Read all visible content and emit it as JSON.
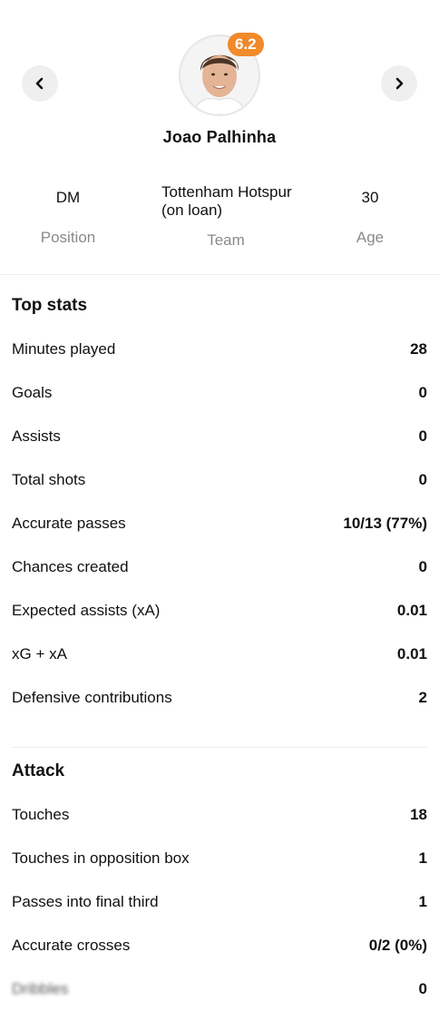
{
  "player": {
    "name": "Joao Palhinha",
    "rating": "6.2",
    "position_value": "DM",
    "position_label": "Position",
    "team_value": "Tottenham Hotspur (on loan)",
    "team_label": "Team",
    "age_value": "30",
    "age_label": "Age"
  },
  "nav": {
    "prev_icon": "chevron-left-icon",
    "next_icon": "chevron-right-icon"
  },
  "colors": {
    "rating_badge": "#f08a2a",
    "muted": "#8a8a8a"
  },
  "top_stats": {
    "title": "Top stats",
    "rows": [
      {
        "label": "Minutes played",
        "value": "28"
      },
      {
        "label": "Goals",
        "value": "0"
      },
      {
        "label": "Assists",
        "value": "0"
      },
      {
        "label": "Total shots",
        "value": "0"
      },
      {
        "label": "Accurate passes",
        "value": "10/13 (77%)"
      },
      {
        "label": "Chances created",
        "value": "0"
      },
      {
        "label": "Expected assists (xA)",
        "value": "0.01"
      },
      {
        "label": "xG + xA",
        "value": "0.01"
      },
      {
        "label": "Defensive contributions",
        "value": "2"
      }
    ]
  },
  "attack": {
    "title": "Attack",
    "rows": [
      {
        "label": "Touches",
        "value": "18"
      },
      {
        "label": "Touches in opposition box",
        "value": "1"
      },
      {
        "label": "Passes into final third",
        "value": "1"
      },
      {
        "label": "Accurate crosses",
        "value": "0/2 (0%)"
      },
      {
        "label": "Dribbles",
        "value": "0"
      }
    ]
  }
}
